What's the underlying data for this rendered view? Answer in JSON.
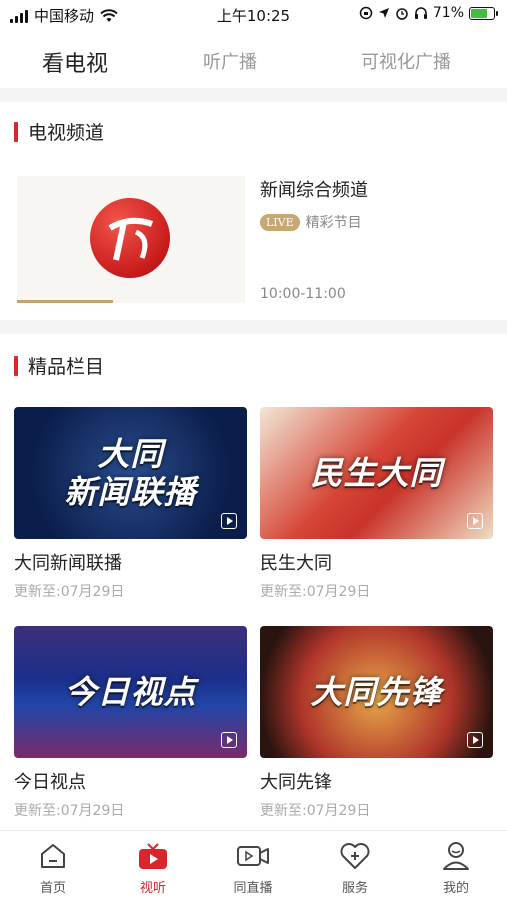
{
  "status_bar": {
    "carrier": "中国移动",
    "time": "上午10:25",
    "battery": "71%",
    "battery_level": 0.71
  },
  "top_tabs": [
    {
      "label": "看电视",
      "active": true
    },
    {
      "label": "听广播",
      "active": false
    },
    {
      "label": "可视化广播",
      "active": false
    }
  ],
  "tv_section": {
    "title": "电视频道",
    "channel": {
      "name": "新闻综合频道",
      "live_badge": "LIVE",
      "program": "精彩节目",
      "time": "10:00-11:00",
      "progress": 0.42
    }
  },
  "programs_section": {
    "title": "精品栏目",
    "items": [
      {
        "thumb_text": "大同\n新闻联播",
        "title": "大同新闻联播",
        "updated": "更新至:07月29日"
      },
      {
        "thumb_text": "民生大同",
        "title": "民生大同",
        "updated": "更新至:07月29日"
      },
      {
        "thumb_text": "今日视点",
        "title": "今日视点",
        "updated": "更新至:07月29日"
      },
      {
        "thumb_text": "大同先锋",
        "title": "大同先锋",
        "updated": "更新至:07月29日"
      }
    ]
  },
  "bottom_nav": [
    {
      "label": "首页",
      "icon": "home-icon",
      "active": false
    },
    {
      "label": "视听",
      "icon": "tv-icon",
      "active": true
    },
    {
      "label": "同直播",
      "icon": "video-camera-icon",
      "active": false
    },
    {
      "label": "服务",
      "icon": "heart-plus-icon",
      "active": false
    },
    {
      "label": "我的",
      "icon": "user-icon",
      "active": false
    }
  ],
  "colors": {
    "accent": "#d8262b",
    "live_badge": "#c7a874"
  }
}
